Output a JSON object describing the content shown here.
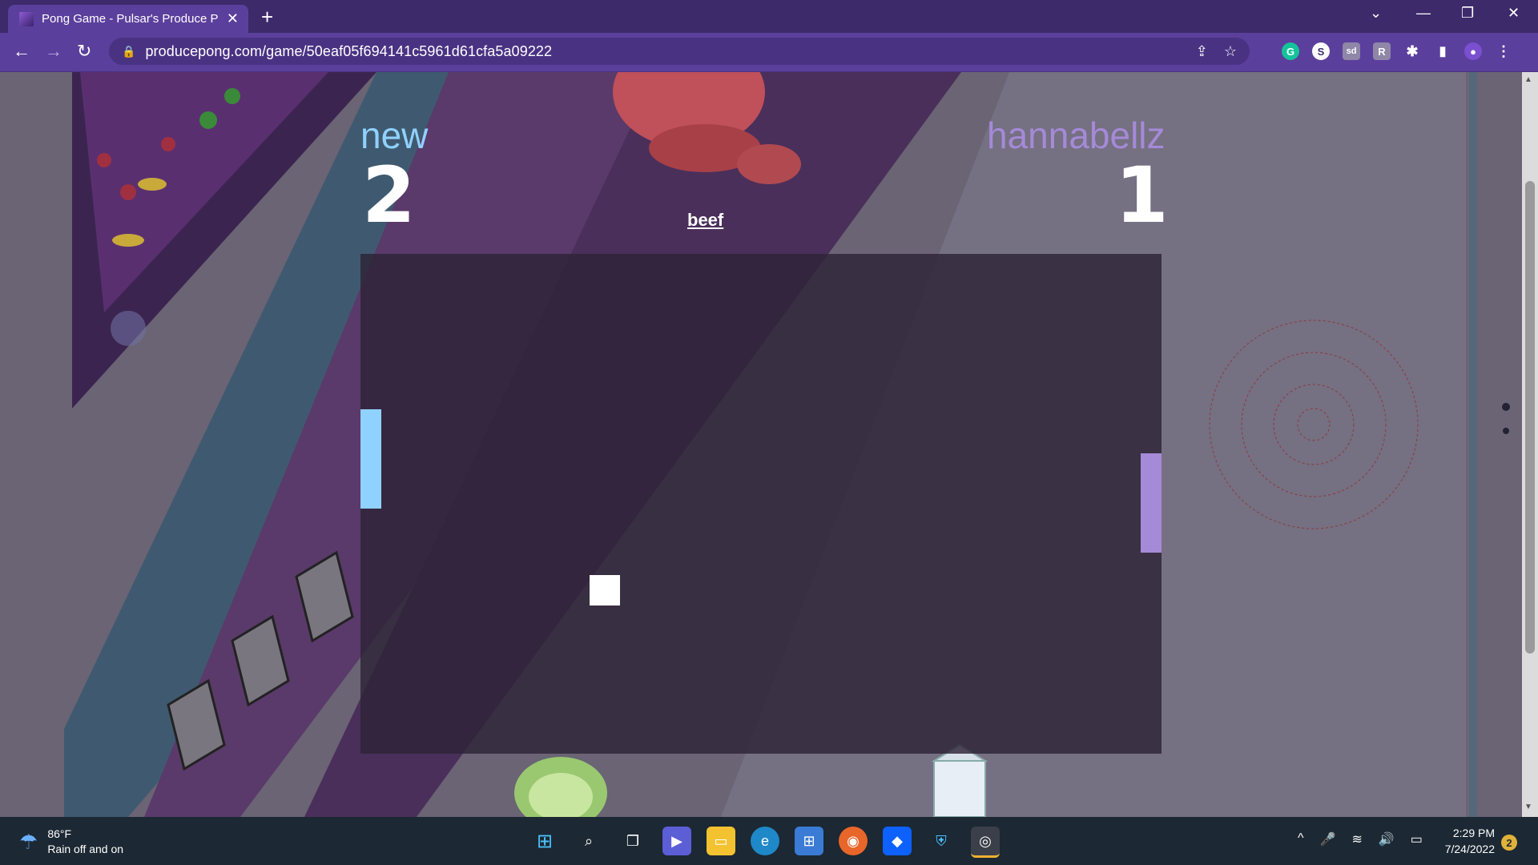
{
  "browser": {
    "tab_title": "Pong Game - Pulsar's Produce Po",
    "url": "producepong.com/game/50eaf05f694141c5961d61cfa5a09222",
    "new_tab_symbol": "+",
    "extensions": [
      {
        "name": "grammarly",
        "letter": "G",
        "color": "#15c39a"
      },
      {
        "name": "s-extension",
        "letter": "S",
        "color": "#ffffff"
      },
      {
        "name": "sd-extension",
        "letter": "sd",
        "color": "#8f86a8"
      },
      {
        "name": "r-extension",
        "letter": "R",
        "color": "#8f86a8"
      }
    ]
  },
  "game": {
    "player_left": {
      "name": "new",
      "score": "2",
      "color": "#8fd1ff"
    },
    "player_right": {
      "name": "hannabellz",
      "score": "1",
      "color": "#a58ad8"
    },
    "item_label": "beef",
    "paddle_left_color": "#8fd1ff",
    "paddle_right_color": "#a58ad8"
  },
  "taskbar": {
    "temperature": "86°F",
    "weather_desc": "Rain off and on",
    "time": "2:29 PM",
    "date": "7/24/2022",
    "notification_count": "2"
  }
}
